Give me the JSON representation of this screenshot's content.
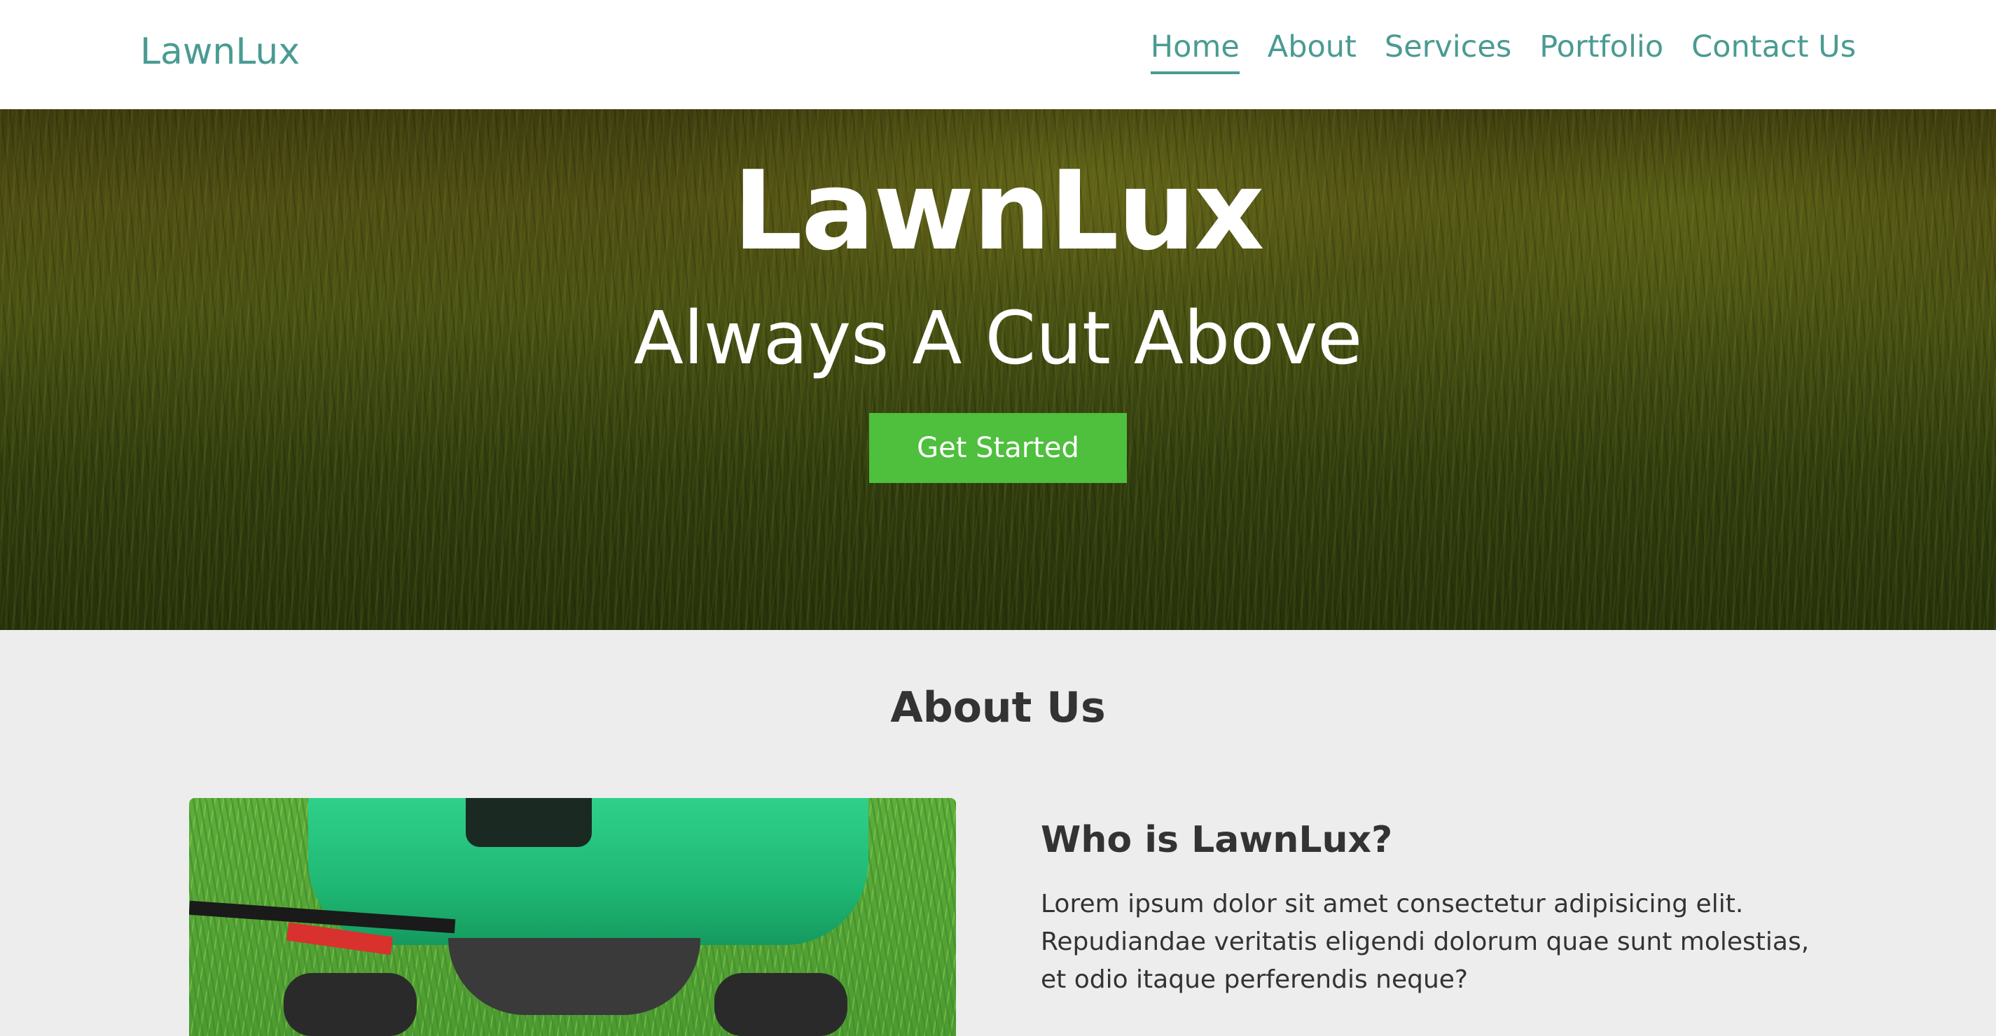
{
  "navbar": {
    "brand": "LawnLux",
    "links": [
      {
        "label": "Home",
        "active": true
      },
      {
        "label": "About",
        "active": false
      },
      {
        "label": "Services",
        "active": false
      },
      {
        "label": "Portfolio",
        "active": false
      },
      {
        "label": "Contact Us",
        "active": false
      }
    ]
  },
  "hero": {
    "title": "LawnLux",
    "subtitle": "Always A Cut Above",
    "cta_label": "Get Started"
  },
  "about": {
    "heading": "About Us",
    "subheading": "Who is LawnLux?",
    "body": "Lorem ipsum dolor sit amet consectetur adipisicing elit. Repudiandae veritatis eligendi dolorum quae sunt molestias, et odio itaque perferendis neque?"
  },
  "colors": {
    "brand": "#4a9b92",
    "cta": "#4fbf3e",
    "text": "#333333",
    "section_bg": "#ededed"
  }
}
